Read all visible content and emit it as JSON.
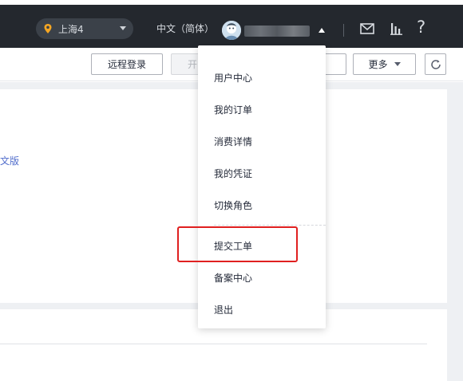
{
  "header": {
    "region": "上海4",
    "language": "中文（简体）",
    "colors": {
      "bg": "#24282e",
      "region_pin": "#f5a623"
    }
  },
  "toolbar": {
    "remote_login": "远程登录",
    "start_partial": "开",
    "partial_button": "",
    "more": "更多"
  },
  "content": {
    "link_partial": "文版"
  },
  "user_menu": {
    "items": [
      {
        "label": "用户中心"
      },
      {
        "label": "我的订单"
      },
      {
        "label": "消费详情"
      },
      {
        "label": "我的凭证"
      },
      {
        "label": "切换角色"
      },
      {
        "label": "提交工单"
      },
      {
        "label": "备案中心"
      },
      {
        "label": "退出"
      }
    ],
    "highlighted_item": "提交工单",
    "highlight_color": "#e02020"
  }
}
